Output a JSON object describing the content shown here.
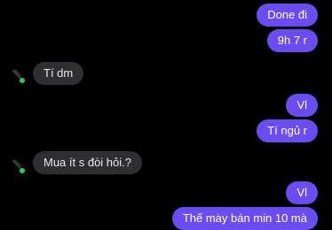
{
  "thread": {
    "messages": [
      {
        "side": "outgoing",
        "text": "Done đi"
      },
      {
        "side": "outgoing",
        "text": "9h 7 r"
      },
      {
        "side": "incoming",
        "text": "Tí dm",
        "avatar": "contact-avatar-icon",
        "online": true
      },
      {
        "side": "outgoing",
        "text": "Vl"
      },
      {
        "side": "outgoing",
        "text": "Tí ngủ r"
      },
      {
        "side": "incoming",
        "text": "Mua ít s đòi hỏi.?",
        "avatar": "contact-avatar-icon",
        "online": true
      },
      {
        "side": "outgoing",
        "text": "Vl"
      },
      {
        "side": "outgoing",
        "text": "Thế mày bán min 10 mà"
      }
    ]
  },
  "colors": {
    "background": "#000000",
    "outgoing_bubble": "#6a4cf0",
    "incoming_bubble": "#2f2f33",
    "presence_dot": "#34c759"
  }
}
